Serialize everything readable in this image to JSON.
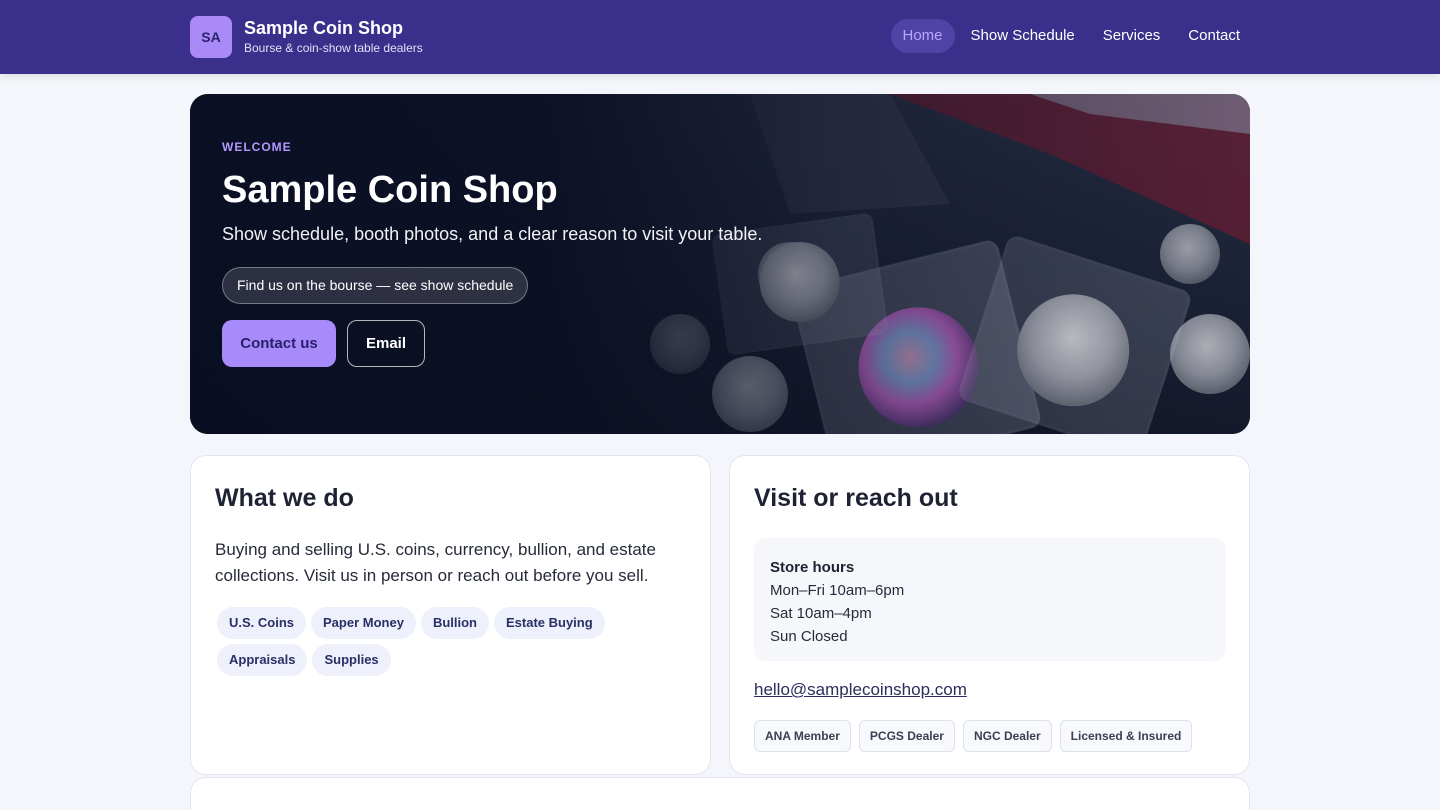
{
  "header": {
    "logo_initials": "SA",
    "brand_name": "Sample Coin Shop",
    "brand_tagline": "Bourse & coin-show table dealers",
    "nav": [
      {
        "label": "Home",
        "active": true
      },
      {
        "label": "Show Schedule",
        "active": false
      },
      {
        "label": "Services",
        "active": false
      },
      {
        "label": "Contact",
        "active": false
      }
    ]
  },
  "hero": {
    "eyebrow": "WELCOME",
    "title": "Sample Coin Shop",
    "subtitle": "Show schedule, booth photos, and a clear reason to visit your table.",
    "pill": "Find us on the bourse — see show schedule",
    "primary_button": "Contact us",
    "secondary_button": "Email"
  },
  "services_card": {
    "title": "What we do",
    "description": "Buying and selling U.S. coins, currency, bullion, and estate collections. Visit us in person or reach out before you sell.",
    "tags": [
      "U.S. Coins",
      "Paper Money",
      "Bullion",
      "Estate Buying",
      "Appraisals",
      "Supplies"
    ]
  },
  "contact_card": {
    "title": "Visit or reach out",
    "hours_title": "Store hours",
    "hours": [
      "Mon–Fri 10am–6pm",
      "Sat 10am–4pm",
      "Sun Closed"
    ],
    "email": "hello@samplecoinshop.com",
    "badges": [
      "ANA Member",
      "PCGS Dealer",
      "NGC Dealer",
      "Licensed & Insured"
    ]
  },
  "colors": {
    "header_bg": "#3a2f8a",
    "accent": "#a78bfa",
    "page_bg": "#f4f6fb"
  }
}
